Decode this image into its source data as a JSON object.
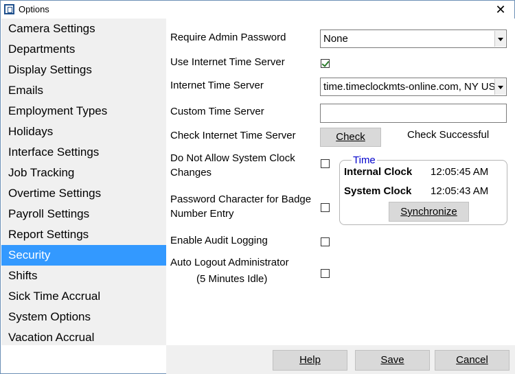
{
  "window": {
    "title": "Options",
    "close_glyph": "✕"
  },
  "sidebar": {
    "items": [
      {
        "label": "Camera Settings",
        "selected": false
      },
      {
        "label": "Departments",
        "selected": false
      },
      {
        "label": "Display Settings",
        "selected": false
      },
      {
        "label": "Emails",
        "selected": false
      },
      {
        "label": "Employment Types",
        "selected": false
      },
      {
        "label": "Holidays",
        "selected": false
      },
      {
        "label": "Interface Settings",
        "selected": false
      },
      {
        "label": "Job Tracking",
        "selected": false
      },
      {
        "label": "Overtime Settings",
        "selected": false
      },
      {
        "label": "Payroll Settings",
        "selected": false
      },
      {
        "label": "Report Settings",
        "selected": false
      },
      {
        "label": "Security",
        "selected": true
      },
      {
        "label": "Shifts",
        "selected": false
      },
      {
        "label": "Sick Time Accrual",
        "selected": false
      },
      {
        "label": "System Options",
        "selected": false
      },
      {
        "label": "Vacation Accrual",
        "selected": false
      }
    ]
  },
  "security": {
    "require_admin_password": {
      "label": "Require Admin Password",
      "value": "None"
    },
    "use_internet_time_server": {
      "label": "Use Internet Time Server",
      "checked": true
    },
    "internet_time_server": {
      "label": "Internet Time Server",
      "value": "time.timeclockmts-online.com, NY USA"
    },
    "custom_time_server": {
      "label": "Custom Time Server",
      "value": ""
    },
    "check_internet_time_server": {
      "label": "Check Internet Time Server",
      "button": "Check",
      "status": "Check Successful"
    },
    "disallow_clock_changes": {
      "label_line1": "Do Not Allow System Clock",
      "label_line2": "Changes",
      "checked": false
    },
    "password_char_badge": {
      "label_line1": "Password Character for Badge",
      "label_line2": "Number Entry",
      "checked": false
    },
    "enable_audit_logging": {
      "label": "Enable Audit Logging",
      "checked": false
    },
    "auto_logout_admin": {
      "label_line1": "Auto Logout Administrator",
      "label_line2": "(5 Minutes Idle)",
      "checked": false
    },
    "time_group": {
      "title": "Time",
      "internal_clock_label": "Internal Clock",
      "internal_clock_value": "12:05:45 AM",
      "system_clock_label": "System Clock",
      "system_clock_value": "12:05:43 AM",
      "synchronize_button": "Synchronize"
    }
  },
  "footer": {
    "help": "Help",
    "save": "Save",
    "cancel": "Cancel"
  },
  "colors": {
    "selection": "#3399ff",
    "group_title": "#0000cc",
    "panel": "#f0f0f0"
  }
}
